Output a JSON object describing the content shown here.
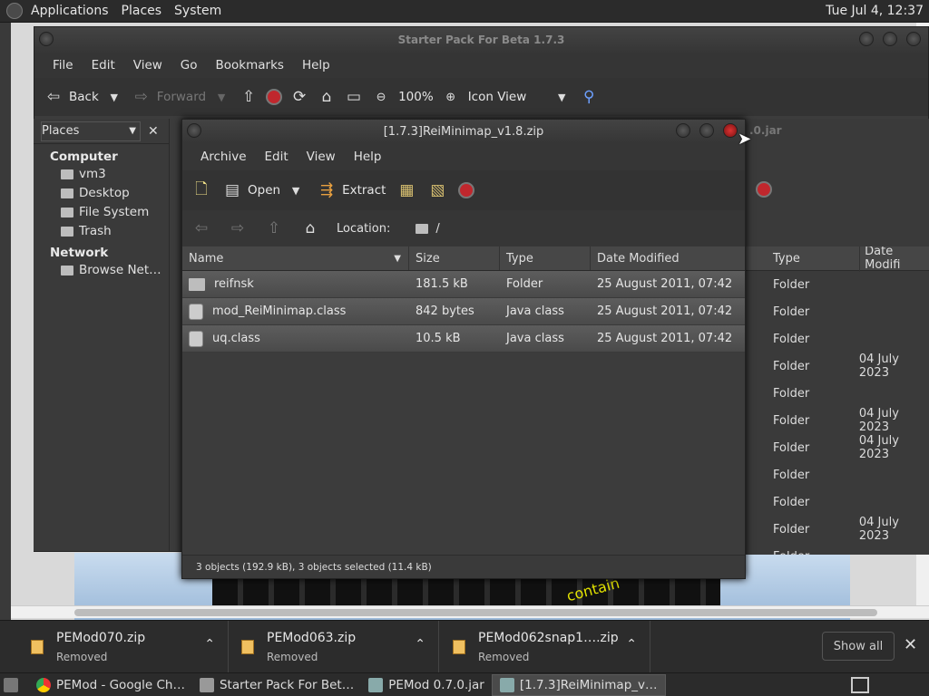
{
  "top_panel": {
    "menus": [
      "Applications",
      "Places",
      "System"
    ],
    "clock": "Tue Jul  4, 12:37"
  },
  "nautilus": {
    "title": "Starter Pack For Beta 1.7.3",
    "menu": [
      "File",
      "Edit",
      "View",
      "Go",
      "Bookmarks",
      "Help"
    ],
    "toolbar": {
      "back": "Back",
      "forward": "Forward",
      "zoom": "100%",
      "view_mode": "Icon View"
    },
    "places": {
      "header": "Places",
      "sections": [
        {
          "title": "Computer",
          "items": [
            "vm3",
            "Desktop",
            "File System",
            "Trash"
          ]
        },
        {
          "title": "Network",
          "items": [
            "Browse Net…"
          ]
        }
      ]
    },
    "behind_title_fragment": ".0.jar",
    "right_list": {
      "columns": [
        "Type",
        "Date Modifi"
      ],
      "rows": [
        {
          "type": "Folder",
          "date": ""
        },
        {
          "type": "Folder",
          "date": ""
        },
        {
          "type": "Folder",
          "date": ""
        },
        {
          "type": "Folder",
          "date": "04 July 2023"
        },
        {
          "type": "Folder",
          "date": ""
        },
        {
          "type": "Folder",
          "date": "04 July 2023"
        },
        {
          "type": "Folder",
          "date": "04 July 2023"
        },
        {
          "type": "Folder",
          "date": ""
        },
        {
          "type": "Folder",
          "date": ""
        },
        {
          "type": "Folder",
          "date": "04 July 2023"
        },
        {
          "type": "Folder",
          "date": ""
        }
      ]
    }
  },
  "archive": {
    "title": "[1.7.3]ReiMinimap_v1.8.zip",
    "menu": [
      "Archive",
      "Edit",
      "View",
      "Help"
    ],
    "toolbar": {
      "open": "Open",
      "extract": "Extract"
    },
    "location_label": "Location:",
    "location_path": "/",
    "columns": [
      "Name",
      "Size",
      "Type",
      "Date Modified"
    ],
    "rows": [
      {
        "name": "reifnsk",
        "size": "181.5 kB",
        "type": "Folder",
        "date": "25 August 2011, 07:42",
        "icon": "folder-icon"
      },
      {
        "name": "mod_ReiMinimap.class",
        "size": "842 bytes",
        "type": "Java class",
        "date": "25 August 2011, 07:42",
        "icon": "class-file-icon"
      },
      {
        "name": "uq.class",
        "size": "10.5 kB",
        "type": "Java class",
        "date": "25 August 2011, 07:42",
        "icon": "class-file-icon"
      }
    ],
    "status": "3 objects (192.9 kB), 3 objects selected (11.4 kB)"
  },
  "background_text": "contain",
  "downloads": {
    "items": [
      {
        "name": "PEMod070.zip",
        "status": "Removed"
      },
      {
        "name": "PEMod063.zip",
        "status": "Removed"
      },
      {
        "name": "PEMod062snap1….zip",
        "status": "Removed"
      }
    ],
    "show_all": "Show all"
  },
  "taskbar": {
    "tasks": [
      {
        "label": "PEMod - Google Ch…",
        "icon": "chrome-icon",
        "active": false
      },
      {
        "label": "Starter Pack For Bet…",
        "icon": "folder-icon",
        "active": false
      },
      {
        "label": "PEMod 0.7.0.jar",
        "icon": "archive-icon",
        "active": false
      },
      {
        "label": "[1.7.3]ReiMinimap_v…",
        "icon": "archive-icon",
        "active": true
      }
    ]
  }
}
